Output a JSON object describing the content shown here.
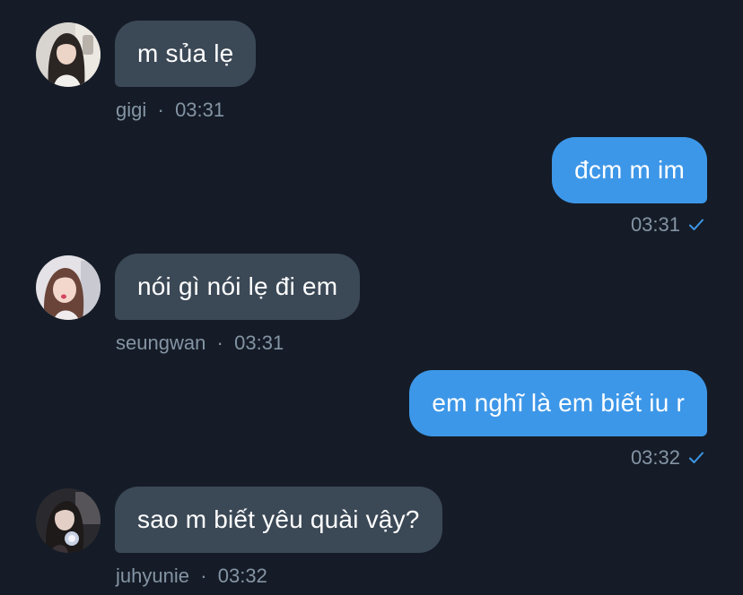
{
  "colors": {
    "background": "#151c27",
    "incoming_bubble": "#3b4856",
    "outgoing_bubble": "#3d97e8",
    "meta_text": "#8494a4",
    "read_check": "#3d97e8"
  },
  "messages": [
    {
      "direction": "incoming",
      "text": "m sủa lẹ",
      "sender": "gigi",
      "separator": "·",
      "time": "03:31",
      "avatar_icon": "user-avatar-icon"
    },
    {
      "direction": "outgoing",
      "text": "đcm m im",
      "time": "03:31",
      "status_icon": "read-check-icon"
    },
    {
      "direction": "incoming",
      "text": "nói gì nói lẹ đi em",
      "sender": "seungwan",
      "separator": "·",
      "time": "03:31",
      "avatar_icon": "user-avatar-icon"
    },
    {
      "direction": "outgoing",
      "text": "em nghĩ là em biết iu r",
      "time": "03:32",
      "status_icon": "read-check-icon"
    },
    {
      "direction": "incoming",
      "text": "sao m biết yêu quài vậy?",
      "sender": "juhyunie",
      "separator": "·",
      "time": "03:32",
      "avatar_icon": "user-avatar-icon"
    }
  ]
}
